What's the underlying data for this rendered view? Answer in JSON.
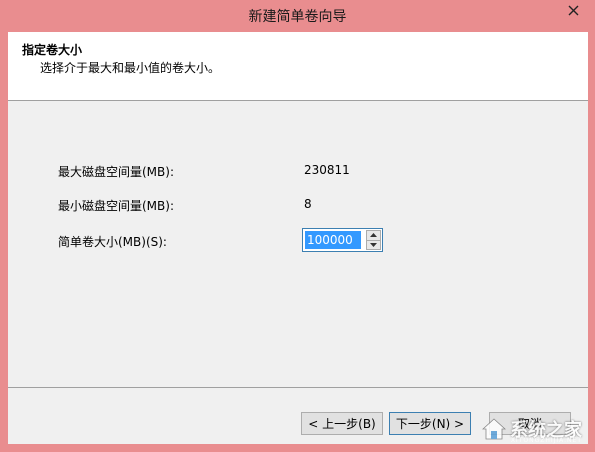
{
  "window": {
    "title": "新建简单卷向导"
  },
  "header": {
    "title": "指定卷大小",
    "subtitle": "选择介于最大和最小值的卷大小。"
  },
  "rows": {
    "max_label": "最大磁盘空间量(MB):",
    "max_value": "230811",
    "min_label": "最小磁盘空间量(MB):",
    "min_value": "8",
    "size_label": "简单卷大小(MB)(S):",
    "size_value": "100000"
  },
  "buttons": {
    "back": "< 上一步(B)",
    "next": "下一步(N) >",
    "cancel": "取消"
  },
  "watermark": {
    "text": "系统之家",
    "sub": "XITONGZHIJIA.NET"
  },
  "colors": {
    "titlebar": "#e98d8f",
    "selection": "#3399ff"
  }
}
